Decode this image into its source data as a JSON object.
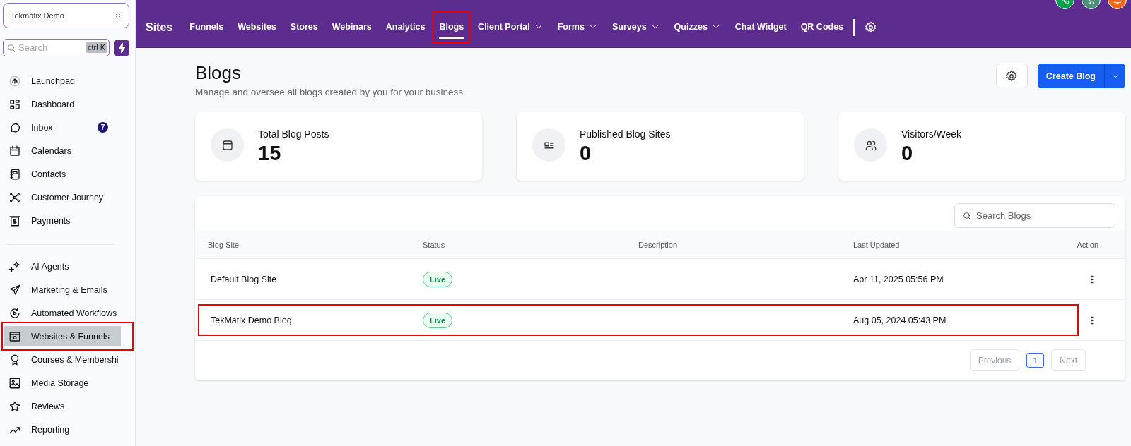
{
  "sidebar": {
    "account": "Tekmatix Demo",
    "search": {
      "placeholder": "Search",
      "shortcut": "ctrl K"
    },
    "groups": [
      [
        {
          "label": "Launchpad",
          "selected": false,
          "highlighted": false
        },
        {
          "label": "Dashboard",
          "selected": false,
          "highlighted": false
        },
        {
          "label": "Inbox",
          "selected": false,
          "highlighted": false,
          "badge": "7"
        },
        {
          "label": "Calendars",
          "selected": false,
          "highlighted": false
        },
        {
          "label": "Contacts",
          "selected": false,
          "highlighted": false
        },
        {
          "label": "Customer Journey",
          "selected": false,
          "highlighted": false
        },
        {
          "label": "Payments",
          "selected": false,
          "highlighted": false
        }
      ],
      [
        {
          "label": "AI Agents",
          "selected": false,
          "highlighted": false
        },
        {
          "label": "Marketing & Emails",
          "selected": false,
          "highlighted": false
        },
        {
          "label": "Automated Workflows",
          "selected": false,
          "highlighted": false
        },
        {
          "label": "Websites & Funnels",
          "selected": true,
          "highlighted": true
        },
        {
          "label": "Courses & Membershi",
          "selected": false,
          "highlighted": false
        },
        {
          "label": "Media Storage",
          "selected": false,
          "highlighted": false
        },
        {
          "label": "Reviews",
          "selected": false,
          "highlighted": false
        },
        {
          "label": "Reporting",
          "selected": false,
          "highlighted": false
        }
      ]
    ]
  },
  "topbar": {
    "title": "Sites",
    "tabs": [
      {
        "label": "Funnels",
        "selected": false,
        "dropdown": false,
        "highlighted": false
      },
      {
        "label": "Websites",
        "selected": false,
        "dropdown": false,
        "highlighted": false
      },
      {
        "label": "Stores",
        "selected": false,
        "dropdown": false,
        "highlighted": false
      },
      {
        "label": "Webinars",
        "selected": false,
        "dropdown": false,
        "highlighted": false
      },
      {
        "label": "Analytics",
        "selected": false,
        "dropdown": false,
        "highlighted": false
      },
      {
        "label": "Blogs",
        "selected": true,
        "dropdown": false,
        "highlighted": true
      },
      {
        "label": "Client Portal",
        "selected": false,
        "dropdown": true,
        "highlighted": false
      },
      {
        "label": "Forms",
        "selected": false,
        "dropdown": true,
        "highlighted": false
      },
      {
        "label": "Surveys",
        "selected": false,
        "dropdown": true,
        "highlighted": false
      },
      {
        "label": "Quizzes",
        "selected": false,
        "dropdown": true,
        "highlighted": false
      },
      {
        "label": "Chat Widget",
        "selected": false,
        "dropdown": false,
        "highlighted": false
      },
      {
        "label": "QR Codes",
        "selected": false,
        "dropdown": false,
        "highlighted": false
      }
    ],
    "quick_actions": [
      {
        "color": "#109e4f"
      },
      {
        "color": "#4b9178"
      },
      {
        "color": "#f26a1b"
      }
    ]
  },
  "page": {
    "title": "Blogs",
    "subtitle": "Manage and oversee all blogs created by you for your business.",
    "primary_button": "Create Blog"
  },
  "stats": [
    {
      "label": "Total Blog Posts",
      "value": "15"
    },
    {
      "label": "Published Blog Sites",
      "value": "0"
    },
    {
      "label": "Visitors/Week",
      "value": "0"
    }
  ],
  "table": {
    "search": {
      "placeholder": "Search Blogs"
    },
    "columns": [
      "Blog Site",
      "Status",
      "Description",
      "Last Updated",
      "Action"
    ],
    "rows": [
      {
        "blog_site": "Default Blog Site",
        "status": "Live",
        "last_updated": "Apr 11, 2025 05:56 PM",
        "highlighted": false
      },
      {
        "blog_site": "TekMatix Demo Blog",
        "status": "Live",
        "last_updated": "Aug 05, 2024 05:43 PM",
        "highlighted": true
      }
    ],
    "pagination": {
      "previous": "Previous",
      "pages": [
        {
          "label": "1",
          "selected": true
        }
      ],
      "next": "Next"
    }
  }
}
